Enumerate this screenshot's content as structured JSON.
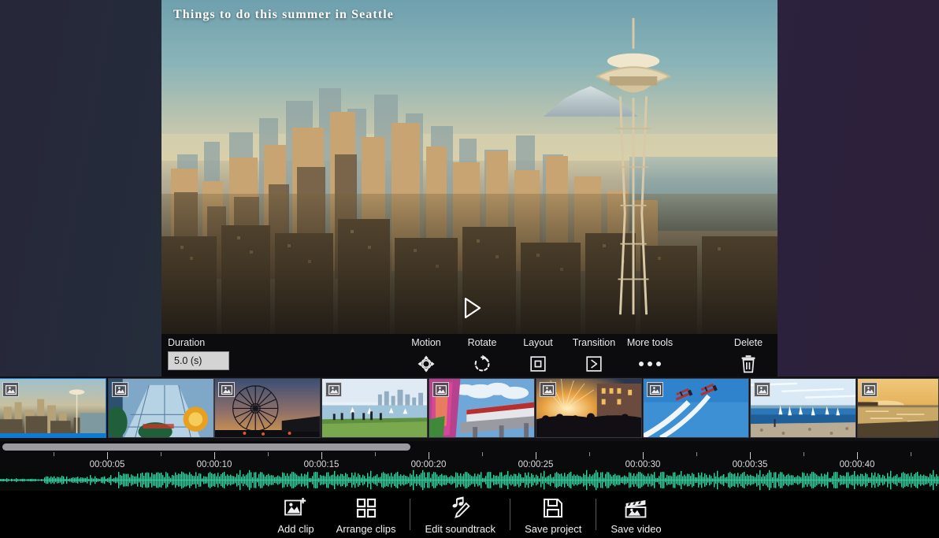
{
  "desktop": {
    "background_left": "#262739",
    "background_right": "#2d1f38"
  },
  "video_preview": {
    "title": "Things to do this summer in Seattle",
    "play_icon": "play-triangle-icon",
    "scene_description": "Seattle skyline with Space Needle at golden hour"
  },
  "clip_toolbar": {
    "accent": "#0e7ad1",
    "items": [
      {
        "label": "Duration",
        "icon": "duration-input",
        "value": "5.0 (s)"
      },
      {
        "label": "Motion",
        "icon": "motion-icon"
      },
      {
        "label": "Rotate",
        "icon": "rotate-icon"
      },
      {
        "label": "Layout",
        "icon": "layout-icon"
      },
      {
        "label": "Transition",
        "icon": "transition-icon"
      },
      {
        "label": "More tools",
        "icon": "ellipsis-icon"
      }
    ],
    "delete": {
      "label": "Delete",
      "icon": "trash-icon"
    }
  },
  "timeline": {
    "selected_clip_index": 0,
    "clips": [
      {
        "name": "Seattle skyline",
        "badge": "photo-icon"
      },
      {
        "name": "Chihuly Garden and Glass",
        "badge": "photo-icon"
      },
      {
        "name": "Great Wheel at sunset",
        "badge": "photo-icon"
      },
      {
        "name": "Gas Works Park lawn",
        "badge": "photo-icon"
      },
      {
        "name": "Monorail mural",
        "badge": "photo-icon"
      },
      {
        "name": "Outdoor concert crowd",
        "badge": "photo-icon"
      },
      {
        "name": "Biplane airshow",
        "badge": "photo-icon"
      },
      {
        "name": "Sailboats on the sound",
        "badge": "photo-icon"
      },
      {
        "name": "Sunset beach",
        "badge": "photo-icon"
      }
    ],
    "ruler_labels": [
      "00:00:05",
      "00:00:10",
      "00:00:15",
      "00:00:20",
      "00:00:25",
      "00:00:30",
      "00:00:35",
      "00:00:40"
    ],
    "scrollbar": {
      "name": "timeline-horizontal-scrollbar"
    },
    "waveform": {
      "name": "soundtrack-waveform",
      "color": "#2fd6a3"
    }
  },
  "action_bar": {
    "actions": [
      {
        "label": "Add clip",
        "icon": "add-image-icon"
      },
      {
        "label": "Arrange clips",
        "icon": "grid-icon"
      },
      {
        "label": "Edit soundtrack",
        "icon": "music-pencil-icon"
      },
      {
        "label": "Save project",
        "icon": "floppy-disk-icon"
      },
      {
        "label": "Save video",
        "icon": "clapperboard-icon"
      }
    ],
    "separators_after": [
      1,
      2,
      3
    ]
  }
}
